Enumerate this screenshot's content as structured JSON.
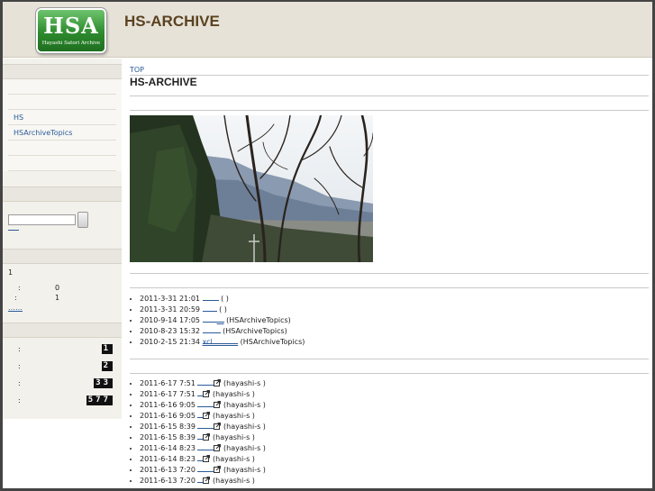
{
  "header": {
    "logo_letters": "HSA",
    "logo_sub": "Hayashi Satori Archive",
    "site_title": "HS-ARCHIVE"
  },
  "sidebar": {
    "menu_items": [
      "",
      "",
      "HS",
      "HSArchiveTopics",
      "",
      ""
    ],
    "stats": {
      "label": "1",
      "row1_value": "0",
      "row2_value": "1",
      "colon": ":"
    },
    "link_more": "……",
    "counters": [
      {
        "colon": ":",
        "value": "1"
      },
      {
        "colon": ":",
        "value": "2"
      },
      {
        "colon": ":",
        "value": "33"
      },
      {
        "colon": ":",
        "value": "577"
      }
    ]
  },
  "main": {
    "breadcrumb": "TOP",
    "page_title": "HS-ARCHIVE",
    "recent_entries": [
      {
        "date": "2011-3-31 21:01",
        "link": "",
        "suffix": "(        )"
      },
      {
        "date": "2011-3-31 20:59",
        "link": "",
        "suffix": "(        )"
      },
      {
        "date": "2010-9-14 17:05",
        "link": "…",
        "suffix": "(HSArchiveTopics)"
      },
      {
        "date": "2010-8-23 15:32",
        "link": "",
        "suffix": "(HSArchiveTopics)"
      },
      {
        "date": "2010-2-15 21:34",
        "link": "xcl        …",
        "suffix": "(HSArchiveTopics)"
      }
    ],
    "recent_updates": [
      {
        "date": "2011-6-17 7:51",
        "suffix": "(hayashi-s    )"
      },
      {
        "date": "2011-6-17 7:51",
        "suffix": "(hayashi-s    )"
      },
      {
        "date": "2011-6-16 9:05",
        "suffix": "(hayashi-s    )"
      },
      {
        "date": "2011-6-16 9:05",
        "suffix": "(hayashi-s    )"
      },
      {
        "date": "2011-6-15 8:39",
        "suffix": "(hayashi-s    )"
      },
      {
        "date": "2011-6-15 8:39",
        "suffix": "(hayashi-s    )"
      },
      {
        "date": "2011-6-14 8:23",
        "suffix": "(hayashi-s    )"
      },
      {
        "date": "2011-6-14 8:23",
        "suffix": "(hayashi-s    )"
      },
      {
        "date": "2011-6-13 7:20",
        "suffix": "(hayashi-s    )"
      },
      {
        "date": "2011-6-13 7:20",
        "suffix": "(hayashi-s    )"
      }
    ]
  },
  "colors": {
    "header_bg": "#e6e2d8",
    "title_brown": "#5b4220",
    "link_blue": "#2a5a9a",
    "logo_green": "#2f8a2f"
  }
}
